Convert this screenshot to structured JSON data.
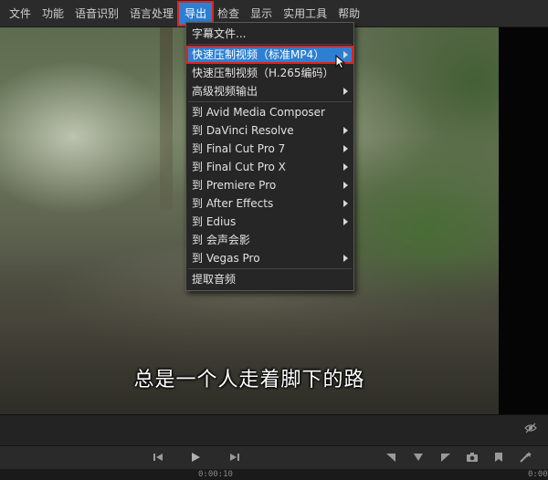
{
  "menubar": {
    "items": [
      {
        "label": "文件"
      },
      {
        "label": "功能"
      },
      {
        "label": "语音识别"
      },
      {
        "label": "语言处理"
      },
      {
        "label": "导出"
      },
      {
        "label": "检查"
      },
      {
        "label": "显示"
      },
      {
        "label": "实用工具"
      },
      {
        "label": "帮助"
      }
    ]
  },
  "dropdown": {
    "items": [
      {
        "label": "字幕文件..."
      },
      {
        "label": "快速压制视频（标准MP4）"
      },
      {
        "label": "快速压制视频（H.265编码）"
      },
      {
        "label": "高级视频输出"
      },
      {
        "label": "到 Avid Media Composer"
      },
      {
        "label": "到 DaVinci Resolve"
      },
      {
        "label": "到 Final Cut Pro 7"
      },
      {
        "label": "到 Final Cut Pro X"
      },
      {
        "label": "到 Premiere Pro"
      },
      {
        "label": "到 After Effects"
      },
      {
        "label": "到 Edius"
      },
      {
        "label": "到 会声会影"
      },
      {
        "label": "到 Vegas Pro"
      },
      {
        "label": "提取音频"
      }
    ]
  },
  "video": {
    "subtitle": "总是一个人走着脚下的路"
  },
  "timeline": {
    "time_mid": "0:00:10",
    "time_right": "0:00"
  },
  "colors": {
    "accent": "#2e7fd1",
    "highlight_border": "#e0231c"
  }
}
